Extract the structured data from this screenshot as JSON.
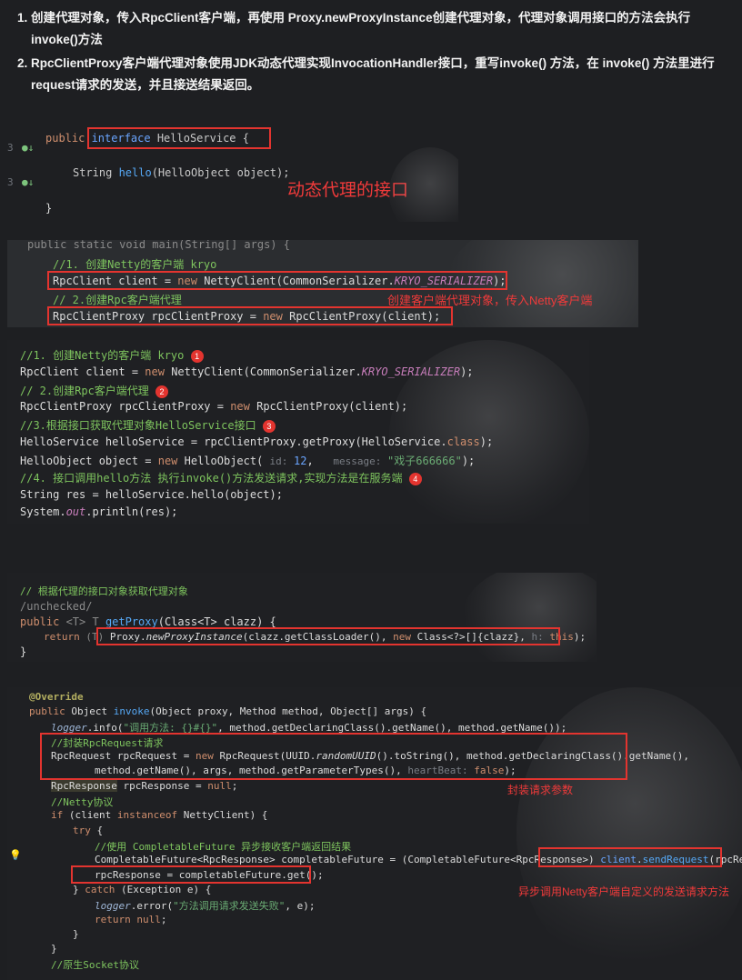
{
  "intro": {
    "item1": "创建代理对象，传入RpcClient客户端，再使用 Proxy.newProxyInstance创建代理对象，代理对象调用接口的方法会执行invoke()方法",
    "item2": "RpcClientProxy客户端代理对象使用JDK动态代理实现InvocationHandler接口，重写invoke() 方法，在 invoke() 方法里进行request请求的发送，并且接送结果返回。"
  },
  "block1": {
    "l1a": "public ",
    "l1b": "interface ",
    "l1c": "HelloService {",
    "l2a": "String ",
    "l2b": "hello",
    "l2c": "(HelloObject object);",
    "l3": "}",
    "note": "动态代理的接口"
  },
  "block2": {
    "top": "public static void main(String[] args) {",
    "c1": "//1. 创建Netty的客户端 kryo",
    "l1a": "RpcClient client = ",
    "l1b": "new ",
    "l1c": "NettyClient(CommonSerializer.",
    "l1d": "KRYO_SERIALIZER",
    "l1e": ");",
    "c2": "// 2.创建Rpc客户端代理",
    "l2a": "RpcClientProxy rpcClientProxy = ",
    "l2b": "new ",
    "l2c": "RpcClientProxy(client);",
    "note": "创建客户端代理对象，传入Netty客户端"
  },
  "block3": {
    "c1": "//1. 创建Netty的客户端 kryo",
    "b1": "1",
    "l1a": "RpcClient client = ",
    "l1b": "new ",
    "l1c": "NettyClient(CommonSerializer.",
    "l1d": "KRYO_SERIALIZER",
    "l1e": ");",
    "c2": "// 2.创建Rpc客户端代理",
    "b2": "2",
    "l2a": "RpcClientProxy rpcClientProxy = ",
    "l2b": "new ",
    "l2c": "RpcClientProxy(client);",
    "c3": "//3.根据接口获取代理对象HelloService接口",
    "b3": "3",
    "l3a": "HelloService helloService = rpcClientProxy.getProxy(HelloService.",
    "l3b": "class",
    "l3c": ");",
    "l4a": "HelloObject object = ",
    "l4b": "new ",
    "l4c": "HelloObject( ",
    "l4d": "id: ",
    "l4e": "12",
    "l4f": ",   ",
    "l4g": "message: ",
    "l4h": "\"戏子666666\"",
    "l4i": ");",
    "c4": "//4. 接口调用hello方法 执行invoke()方法发送请求,实现方法是在服务端",
    "b4": "4",
    "l5": "String res = helloService.hello(object);",
    "l6a": "System.",
    "l6b": "out",
    "l6c": ".println(res);"
  },
  "block4": {
    "c1": "// 根据代理的接口对象获取代理对象",
    "c2": "/unchecked/",
    "l1a": "public ",
    "l1b": "<T> T ",
    "l1c": "getProxy",
    "l1d": "(Class<T> clazz) {",
    "l2a": "return ",
    "l2b": "(T) ",
    "l2c": "Proxy.",
    "l2d": "newProxyInstance",
    "l2e": "(clazz.getClassLoader(), ",
    "l2f": "new ",
    "l2g": "Class<?>[]{clazz}, ",
    "l2h": "h: ",
    "l2i": "this",
    "l2j": ");",
    "l3": "}"
  },
  "block5": {
    "ann": "@Override",
    "l1a": "public ",
    "l1b": "Object ",
    "l1c": "invoke",
    "l1d": "(Object proxy, Method method, Object[] args) {",
    "l2a": "logger",
    "l2b": ".info(",
    "l2c": "\"调用方法: {}#{}\"",
    "l2d": ", method.getDeclaringClass().getName(), method.getName());",
    "c1": "//封装RpcRequest请求",
    "l3a": "RpcRequest rpcRequest = ",
    "l3b": "new ",
    "l3c": "RpcRequest(UUID.",
    "l3d": "randomUUID",
    "l3e": "().toString(), method.getDeclaringClass().getName(),",
    "l4a": "method.getName(), args, method.getParameterTypes(), ",
    "l4b": "heartBeat: ",
    "l4c": "false",
    "l4d": ");",
    "l5a": "RpcResponse",
    "l5b": " rpcResponse = ",
    "l5c": "null",
    "l5d": ";",
    "c2": "//Netty协议",
    "l6a": "if ",
    "l6b": "(client ",
    "l6c": "instanceof ",
    "l6d": "NettyClient) {",
    "l7a": "try ",
    "l7b": "{",
    "c3": "//使用 CompletableFuture 异步接收客户端返回结果",
    "l8a": "CompletableFuture<RpcResponse> completableFuture = (CompletableFuture<RpcResponse>) ",
    "l8b": "client",
    "l8c": ".",
    "l8d": "sendRequest",
    "l8e": "(rpcRequest);",
    "l9": "rpcResponse = completableFuture.get();",
    "l10a": "} ",
    "l10b": "catch ",
    "l10c": "(Exception e) {",
    "l11a": "logger",
    "l11b": ".error(",
    "l11c": "\"方法调用请求发送失败\"",
    "l11d": ", e);",
    "l12a": "return ",
    "l12b": "null",
    "l12c": ";",
    "l13": "}",
    "l14": "}",
    "c4": "//原生Socket协议",
    "note1": "封装请求参数",
    "note2": "异步调用Netty客户端自定义的发送请求方法"
  },
  "colors": {
    "annotation_red": "#e3342f",
    "comment_green": "#7ec45e",
    "keyword": "#cf8e6d"
  }
}
